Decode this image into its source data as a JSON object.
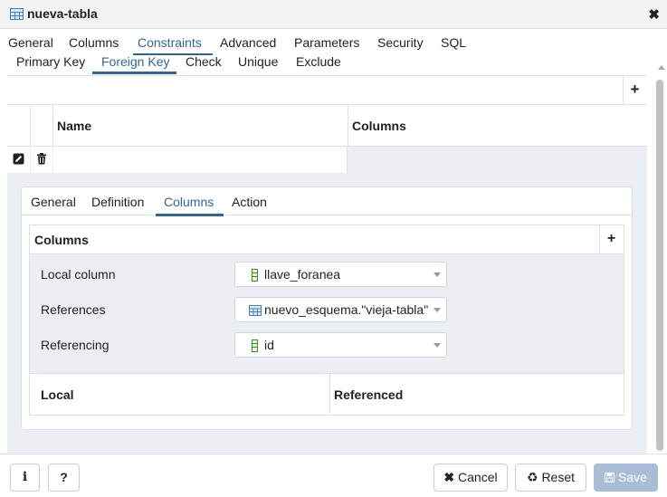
{
  "window": {
    "title": "nueva-tabla"
  },
  "main_tabs": [
    "General",
    "Columns",
    "Constraints",
    "Advanced",
    "Parameters",
    "Security",
    "SQL"
  ],
  "active_main_tab": "Constraints",
  "constraint_tabs": [
    "Primary Key",
    "Foreign Key",
    "Check",
    "Unique",
    "Exclude"
  ],
  "active_constraint_tab": "Foreign Key",
  "fk_grid": {
    "headers": {
      "name": "Name",
      "columns": "Columns"
    },
    "rows": [
      {
        "name": "",
        "columns": ""
      }
    ]
  },
  "detail_tabs": [
    "General",
    "Definition",
    "Columns",
    "Action"
  ],
  "active_detail_tab": "Columns",
  "columns_section": {
    "title": "Columns",
    "fields": [
      {
        "label": "Local column",
        "value": "llave_foranea",
        "icon": "column-icon"
      },
      {
        "label": "References",
        "value": "nuevo_esquema.\"vieja-tabla\"",
        "icon": "table-icon"
      },
      {
        "label": "Referencing",
        "value": "id",
        "icon": "column-icon"
      }
    ],
    "grid_headers": {
      "local": "Local",
      "referenced": "Referenced"
    }
  },
  "footer": {
    "info_label": "i",
    "help_label": "?",
    "cancel_label": "Cancel",
    "reset_label": "Reset",
    "save_label": "Save"
  },
  "colors": {
    "accent": "#326690",
    "save_disabled": "#a8bed6",
    "panel_bg": "#ebeef3"
  }
}
